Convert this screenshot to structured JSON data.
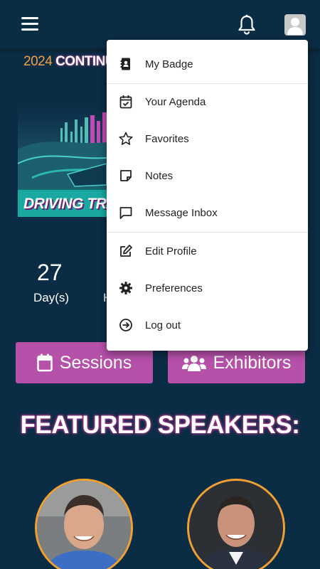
{
  "header": {
    "menu_icon": "hamburger-icon",
    "notification_icon": "bell-icon",
    "profile_icon": "user-avatar-icon"
  },
  "banner": {
    "year": "2024",
    "title_partial": "CONTINU",
    "caption_partial": "DRIVING TRA"
  },
  "countdown": {
    "days_value": "27",
    "days_label": "Day(s)",
    "hours_label_partial": "H"
  },
  "buttons": {
    "sessions_label": "Sessions",
    "exhibitors_label": "Exhibitors"
  },
  "featured": {
    "heading": "FEATURED SPEAKERS:"
  },
  "dropdown": {
    "items": [
      {
        "label": "My Badge",
        "icon": "badge-icon"
      },
      {
        "label": "Your Agenda",
        "icon": "calendar-check-icon"
      },
      {
        "label": "Favorites",
        "icon": "star-icon"
      },
      {
        "label": "Notes",
        "icon": "note-icon"
      },
      {
        "label": "Message Inbox",
        "icon": "message-icon"
      },
      {
        "label": "Edit Profile",
        "icon": "edit-icon"
      },
      {
        "label": "Preferences",
        "icon": "gear-icon"
      },
      {
        "label": "Log out",
        "icon": "logout-icon"
      }
    ]
  },
  "colors": {
    "background": "#0b2c45",
    "button_purple": "#b651a9",
    "accent_orange": "#f0a032",
    "teal": "#19a9a1"
  }
}
